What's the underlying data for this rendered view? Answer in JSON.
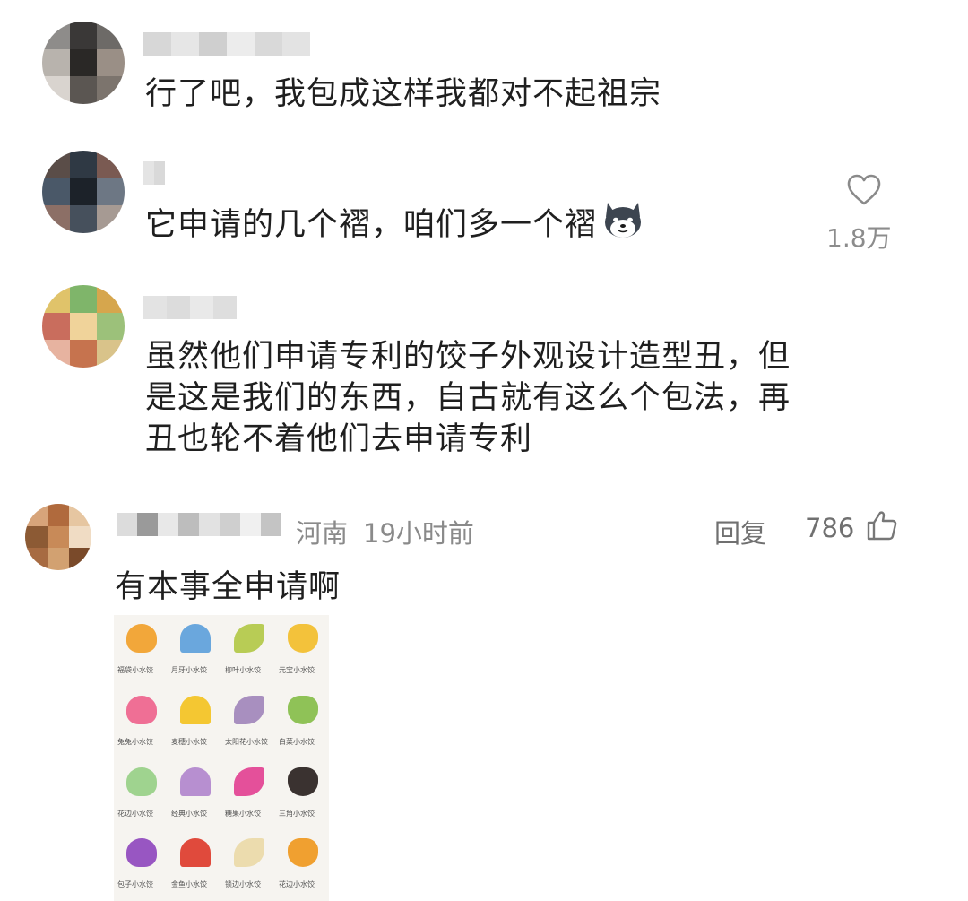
{
  "comments": [
    {
      "text": "行了吧，我包成这样我都对不起祖宗",
      "avatar_colors": [
        "#8e8c8a",
        "#3a3837",
        "#6d6a67",
        "#b8b3ad",
        "#2a2826",
        "#9a8f86",
        "#d9d4cf",
        "#5b5652",
        "#7c746d"
      ],
      "name_blur_colors": [
        "#d7d7d7",
        "#e6e6e6",
        "#cfcfcf",
        "#ececec",
        "#d9d9d9",
        "#e3e3e3"
      ]
    },
    {
      "text": "它申请的几个褶，咱们多一个褶",
      "emoji_icon": "shiba-dog-emoji-icon",
      "avatar_colors": [
        "#5a4d48",
        "#2f3944",
        "#7a5a52",
        "#4a5868",
        "#1c2229",
        "#6d7784",
        "#8c6f66",
        "#46505c",
        "#a69a93"
      ],
      "name_blur_colors": [
        "#e4e4e4",
        "#d9d9d9"
      ],
      "like_icon": "heart-outline-icon",
      "like_count": "1.8万"
    },
    {
      "text_lines": [
        "虽然他们申请专利的饺子外观设计造型丑，但",
        "是这是我们的东西，自古就有这么个包法，再",
        "丑也轮不着他们去申请专利"
      ],
      "avatar_colors": [
        "#e0c36a",
        "#7fb56a",
        "#d6a64d",
        "#c96d5d",
        "#f0d39a",
        "#9cc17a",
        "#e7b3a0",
        "#c6734e",
        "#d9c38a"
      ],
      "name_blur_colors": [
        "#e3e3e3",
        "#dcdcdc",
        "#e9e9e9",
        "#dedede"
      ]
    },
    {
      "location": "河南",
      "time": "19小时前",
      "reply_label": "回复",
      "like_count": "786",
      "like_icon": "thumbs-up-outline-icon",
      "text": "有本事全申请啊",
      "avatar_colors": [
        "#d7a47a",
        "#b06a3d",
        "#e6c6a1",
        "#8c5a34",
        "#c88a58",
        "#f0dcc4",
        "#a76b42",
        "#d2a171",
        "#7a4a2a"
      ],
      "name_blur_colors": [
        "#dcdcdc",
        "#9a9a9a",
        "#e8e8e8",
        "#bdbdbd",
        "#e2e2e2",
        "#cfcfcf",
        "#f0f0f0",
        "#c4c4c4"
      ],
      "image": {
        "dumplings": [
          {
            "color": "#f2a73a",
            "caption": "福袋小水饺"
          },
          {
            "color": "#6aa7dd",
            "caption": "月牙小水饺"
          },
          {
            "color": "#b8cc55",
            "caption": "柳叶小水饺"
          },
          {
            "color": "#f3c23b",
            "caption": "元宝小水饺"
          },
          {
            "color": "#ef6f95",
            "caption": "兔兔小水饺"
          },
          {
            "color": "#f4c732",
            "caption": "麦穗小水饺"
          },
          {
            "color": "#a88fbf",
            "caption": "太阳花小水饺"
          },
          {
            "color": "#8fc257",
            "caption": "白菜小水饺"
          },
          {
            "color": "#9fd38f",
            "caption": "花边小水饺"
          },
          {
            "color": "#b78fd0",
            "caption": "经典小水饺"
          },
          {
            "color": "#e4509a",
            "caption": "糖果小水饺"
          },
          {
            "color": "#3a3230",
            "caption": "三角小水饺"
          },
          {
            "color": "#9856c2",
            "caption": "包子小水饺"
          },
          {
            "color": "#e04a3c",
            "caption": "金鱼小水饺"
          },
          {
            "color": "#ecdcae",
            "caption": "锁边小水饺"
          },
          {
            "color": "#f0a030",
            "caption": "花边小水饺"
          }
        ]
      }
    }
  ]
}
